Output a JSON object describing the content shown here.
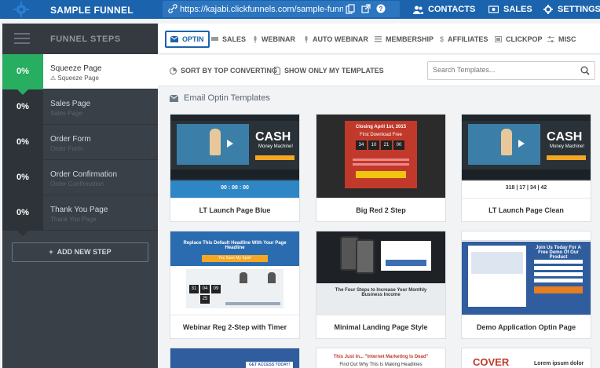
{
  "app": {
    "title": "SAMPLE FUNNEL",
    "url": "https://kajabi.clickfunnels.com/sample-funnel"
  },
  "nav": [
    {
      "label": "CONTACTS",
      "icon": "users-icon"
    },
    {
      "label": "SALES",
      "icon": "money-icon"
    },
    {
      "label": "SETTINGS",
      "icon": "gear-icon"
    }
  ],
  "sidebar": {
    "title": "FUNNEL STEPS",
    "steps": [
      {
        "percent": "0%",
        "name": "Squeeze Page",
        "sub": "Squeeze Page",
        "active": true
      },
      {
        "percent": "0%",
        "name": "Sales Page",
        "sub": "Sales Page",
        "active": false
      },
      {
        "percent": "0%",
        "name": "Order Form",
        "sub": "Order Form",
        "active": false
      },
      {
        "percent": "0%",
        "name": "Order Confirmation",
        "sub": "Order Confirmation",
        "active": false
      },
      {
        "percent": "0%",
        "name": "Thank You Page",
        "sub": "Thank You Page",
        "active": false
      }
    ],
    "add_step": "ADD NEW STEP"
  },
  "tabs": [
    {
      "label": "OPTIN",
      "active": true
    },
    {
      "label": "SALES"
    },
    {
      "label": "WEBINAR"
    },
    {
      "label": "AUTO WEBINAR"
    },
    {
      "label": "MEMBERSHIP"
    },
    {
      "label": "AFFILIATES"
    },
    {
      "label": "CLICKPOP"
    },
    {
      "label": "MISC"
    }
  ],
  "toolbar": {
    "sort_label": "SORT BY TOP CONVERTING",
    "mine_label": "SHOW ONLY MY TEMPLATES",
    "search_placeholder": "Search Templates..."
  },
  "section_title": "Email Optin Templates",
  "templates": [
    {
      "name": "LT Launch Page Blue",
      "headline": "CASH",
      "sub": "Money Machine!",
      "countdown": "00 : 00 : 00"
    },
    {
      "name": "Big Red 2 Step",
      "headline": "Closing April 1st, 2015",
      "sub": "First Download Free",
      "countdown": [
        "34",
        "10",
        "21",
        "00"
      ]
    },
    {
      "name": "LT Launch Page Clean",
      "headline": "CASH",
      "sub": "Money Machine!",
      "countdown": "318 | 17 | 34 | 42"
    },
    {
      "name": "Webinar Reg 2-Step with Timer",
      "headline": "Replace This Default Headline With Your Page Headline",
      "cta": "Yes Save My Spot!",
      "countdown": [
        "31",
        "04",
        "09",
        "25"
      ]
    },
    {
      "name": "Minimal Landing Page Style",
      "headline": "The Four Steps to Increase Your Monthly Business Income"
    },
    {
      "name": "Demo Application Optin Page",
      "headline": "Join Us Today For A Free Demo Of Our Product"
    },
    {
      "name": "",
      "headline": "GET ACCESS TODAY!"
    },
    {
      "name": "",
      "headline": "This Just In... \"Internet Marketing Is Dead\"",
      "sub": "Find Out Why This Is Making Headlines"
    },
    {
      "name": "",
      "headline": "COVER",
      "sub": "Lorem ipsum dolor"
    }
  ],
  "colors": {
    "brand": "#1b63ad",
    "success": "#27ae60",
    "sidebar": "#3a4048"
  }
}
